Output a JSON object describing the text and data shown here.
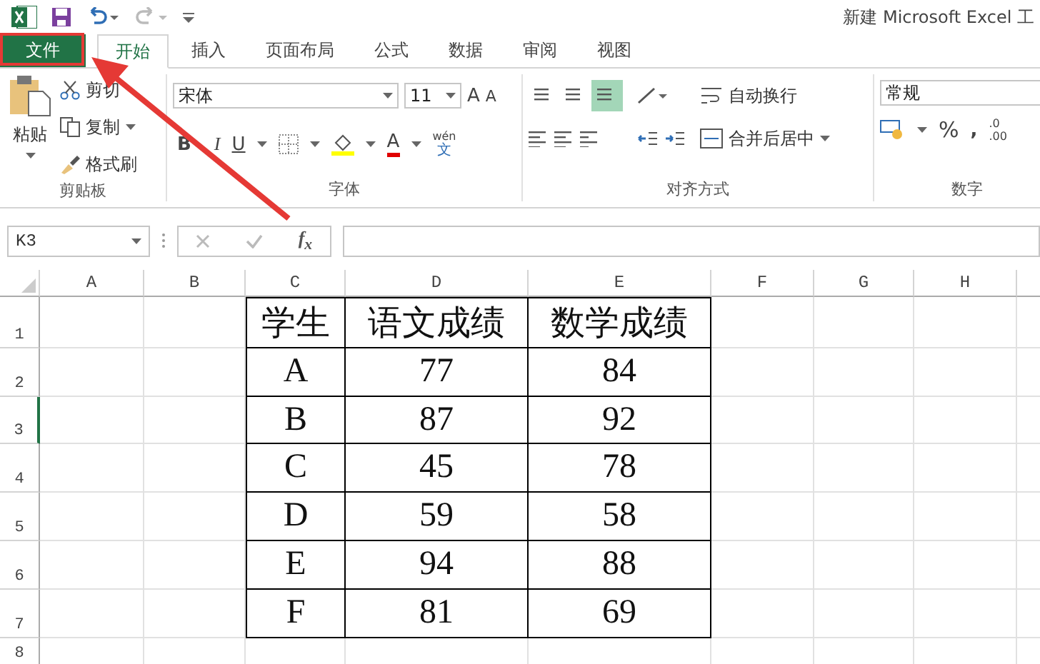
{
  "title": "新建 Microsoft Excel 工",
  "tabs": [
    {
      "label": "文件",
      "kind": "file",
      "selected": false
    },
    {
      "label": "开始",
      "kind": "tab",
      "selected": true
    },
    {
      "label": "插入",
      "kind": "tab",
      "selected": false
    },
    {
      "label": "页面布局",
      "kind": "tab",
      "selected": false
    },
    {
      "label": "公式",
      "kind": "tab",
      "selected": false
    },
    {
      "label": "数据",
      "kind": "tab",
      "selected": false
    },
    {
      "label": "审阅",
      "kind": "tab",
      "selected": false
    },
    {
      "label": "视图",
      "kind": "tab",
      "selected": false
    }
  ],
  "clipboard": {
    "paste": "粘贴",
    "cut": "剪切",
    "copy": "复制",
    "format_painter": "格式刷",
    "label": "剪贴板"
  },
  "font": {
    "name": "宋体",
    "size": "11",
    "grow": "A",
    "shrink": "A",
    "bold": "B",
    "italic": "I",
    "underline": "U",
    "color_letter": "A",
    "phonetic_top": "wén",
    "phonetic_bottom": "文",
    "label": "字体"
  },
  "alignment": {
    "vertical": [
      {
        "selected": false
      },
      {
        "selected": false
      },
      {
        "selected": true
      }
    ],
    "wrap": "自动换行",
    "merge": "合并后居中",
    "label": "对齐方式"
  },
  "number": {
    "format": "常规",
    "percent": "%",
    "comma": ",",
    "decimal_top": ".0",
    "decimal_bottom": ".00",
    "label": "数字"
  },
  "formula_bar": {
    "name_box": "K3",
    "fx": "f$_{x}$"
  },
  "columns": [
    "A",
    "B",
    "C",
    "D",
    "E",
    "F",
    "G",
    "H"
  ],
  "rows": [
    {
      "number": "1",
      "selected": false
    },
    {
      "number": "2",
      "selected": false
    },
    {
      "number": "3",
      "selected": true
    },
    {
      "number": "4",
      "selected": false
    },
    {
      "number": "5",
      "selected": false
    },
    {
      "number": "6",
      "selected": false
    },
    {
      "number": "7",
      "selected": false
    },
    {
      "number": "8",
      "selected": false
    }
  ],
  "table": {
    "header": [
      "学生",
      "语文成绩",
      "数学成绩"
    ],
    "rows": [
      [
        "A",
        "77",
        "84"
      ],
      [
        "B",
        "87",
        "92"
      ],
      [
        "C",
        "45",
        "78"
      ],
      [
        "D",
        "59",
        "58"
      ],
      [
        "E",
        "94",
        "88"
      ],
      [
        "F",
        "81",
        "69"
      ]
    ]
  }
}
